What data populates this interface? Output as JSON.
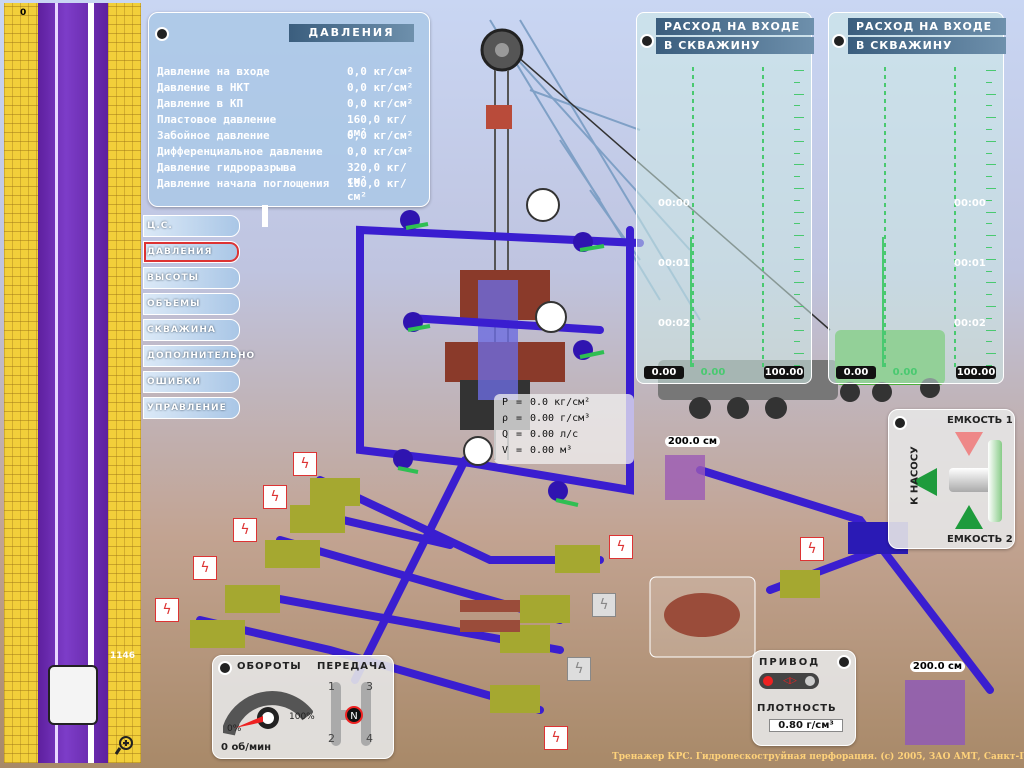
{
  "well": {
    "top_depth": "0",
    "marker_depth": "1146"
  },
  "pressure_panel": {
    "title": "ДАВЛЕНИЯ",
    "rows": [
      {
        "label": "Давление на входе",
        "value": "0,0 кг/см²"
      },
      {
        "label": "Давление в НКТ",
        "value": "0,0 кг/см²"
      },
      {
        "label": "Давление в КП",
        "value": "0,0 кг/см²"
      },
      {
        "label": "Пластовое давление",
        "value": "160,0 кг/см²"
      },
      {
        "label": "Забойное давление",
        "value": "0,0 кг/см²"
      },
      {
        "label": "Дифференциальное давление",
        "value": "0,0 кг/см²"
      },
      {
        "label": "Давление гидроразрыва",
        "value": "320,0 кг/см²"
      },
      {
        "label": "Давление начала поглощения",
        "value": "180,0 кг/см²"
      }
    ]
  },
  "menu": [
    {
      "label": "Ц.С.",
      "active": false
    },
    {
      "label": "ДАВЛЕНИЯ",
      "active": true
    },
    {
      "label": "ВЫСОТЫ",
      "active": false
    },
    {
      "label": "ОБЪЕМЫ",
      "active": false
    },
    {
      "label": "СКВАЖИНА",
      "active": false
    },
    {
      "label": "ДОПОЛНИТЕЛЬНО",
      "active": false
    },
    {
      "label": "ОШИБКИ",
      "active": false
    },
    {
      "label": "УПРАВЛЕНИЕ",
      "active": false
    }
  ],
  "flow_panels": [
    {
      "title1": "РАСХОД НА ВХОДЕ",
      "title2": "В СКВАЖИНУ",
      "time_labels": [
        "00:00",
        "00:01",
        "00:02"
      ],
      "min": "0.00",
      "current": "0.00",
      "max": "100.00"
    },
    {
      "title1": "РАСХОД НА ВХОДЕ",
      "title2": "В СКВАЖИНУ",
      "time_labels": [
        "00:00",
        "00:01",
        "00:02"
      ],
      "min": "0.00",
      "current": "0.00",
      "max": "100.00"
    }
  ],
  "readout": [
    {
      "sym": "P",
      "value": "0.0 кг/см²"
    },
    {
      "sym": "ρ",
      "value": "0.00 г/см³"
    },
    {
      "sym": "Q",
      "value": "0.00 л/с"
    },
    {
      "sym": "V",
      "value": "0.00 м³"
    }
  ],
  "tanks": {
    "upper_level": "200.0 см",
    "lower_level": "200.0 см"
  },
  "valve_panel": {
    "tank1": "ЕМКОСТЬ 1",
    "tank2": "ЕМКОСТЬ 2",
    "to_pump": "К НАСОСУ"
  },
  "rpm_panel": {
    "title_rpm": "ОБОРОТЫ",
    "title_gear": "ПЕРЕДАЧА",
    "pct_min": "0%",
    "pct_max": "100%",
    "rpm_value": "0 об/мин",
    "gears": [
      "1",
      "2",
      "3",
      "4"
    ],
    "neutral": "N"
  },
  "drive_panel": {
    "drive": "ПРИВОД",
    "density_label": "ПЛОТНОСТЬ",
    "density_value": "0.80 г/см³"
  },
  "footer": "Тренажер КРС. Гидропескоструйная перфорация. (с) 2005, ЗАО АМТ, Санкт-Петербург",
  "colors": {
    "pipe": "#3a1ed0",
    "accent_green": "#2fbf52",
    "alarm_red": "#e03b2c"
  }
}
